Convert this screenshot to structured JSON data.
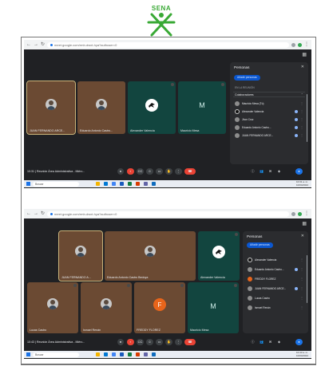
{
  "logo": {
    "text": "SENA",
    "color": "#39a935"
  },
  "browser": {
    "url": "meet.google.com/rmb-dwxt-hya?authuser=0",
    "nav_icons": [
      "back-icon",
      "forward-icon",
      "reload-icon"
    ]
  },
  "screenshot1": {
    "tiles": [
      {
        "name": "JUAN FERNANDO ARCE...",
        "kind": "photo",
        "active": true
      },
      {
        "name": "Eduardo Antonio Castro...",
        "kind": "photo"
      },
      {
        "name": "Alexander Valencia",
        "kind": "icon"
      },
      {
        "name": "Mauricio Mesa",
        "kind": "letter",
        "letter": "M"
      }
    ],
    "panel": {
      "title": "Personas",
      "add_button": "Añadir personas",
      "section": "EN LA REUNIÓN",
      "group": "Colaboradores",
      "group_count": "5",
      "people": [
        "Mauricio Mesa (Tú)",
        "Alexander Valencia",
        "Jhon Cruz",
        "Eduardo Antonio Castro...",
        "JUAN FERNANDO ARCE..."
      ]
    },
    "meeting_label": "10:31 | Reunión Área Administrativa - Miérc...",
    "taskbar": {
      "search": "Buscar",
      "time": "10:31 a. m.",
      "date": "10/04/2024"
    }
  },
  "screenshot2": {
    "tiles": [
      {
        "name": "JUAN FERNANDO A...",
        "kind": "photo",
        "active": true
      },
      {
        "name": "Eduardo Antonio Castro Bedoya",
        "kind": "photo"
      },
      {
        "name": "Alexander Valencia",
        "kind": "icon"
      },
      {
        "name": "Lucas Castro",
        "kind": "photo"
      },
      {
        "name": "Ismael Renán",
        "kind": "photo"
      },
      {
        "name": "FREDDY FLOREZ",
        "kind": "letter",
        "letter": "F"
      },
      {
        "name": "Mauricio Mesa",
        "kind": "letter",
        "letter": "M"
      }
    ],
    "panel": {
      "title": "Personas",
      "add_button": "Añadir personas",
      "people": [
        "Alexander Valencia",
        "Eduardo Antonio Castro...",
        "FREDDY FLOREZ",
        "JUAN FERNANDO ARCE...",
        "Lucas Castro",
        "Ismael Renán"
      ]
    },
    "meeting_label": "10:43 | Reunión Área Administrativa - Miérc...",
    "taskbar": {
      "search": "Buscar",
      "time": "10:43 a. m.",
      "date": "10/04/2024"
    }
  },
  "colors": {
    "meet_bg": "#202124",
    "tile_brown": "#6b4a33",
    "tile_teal": "#12453f",
    "end_call": "#ea4335",
    "accent_blue": "#1a73e8"
  }
}
